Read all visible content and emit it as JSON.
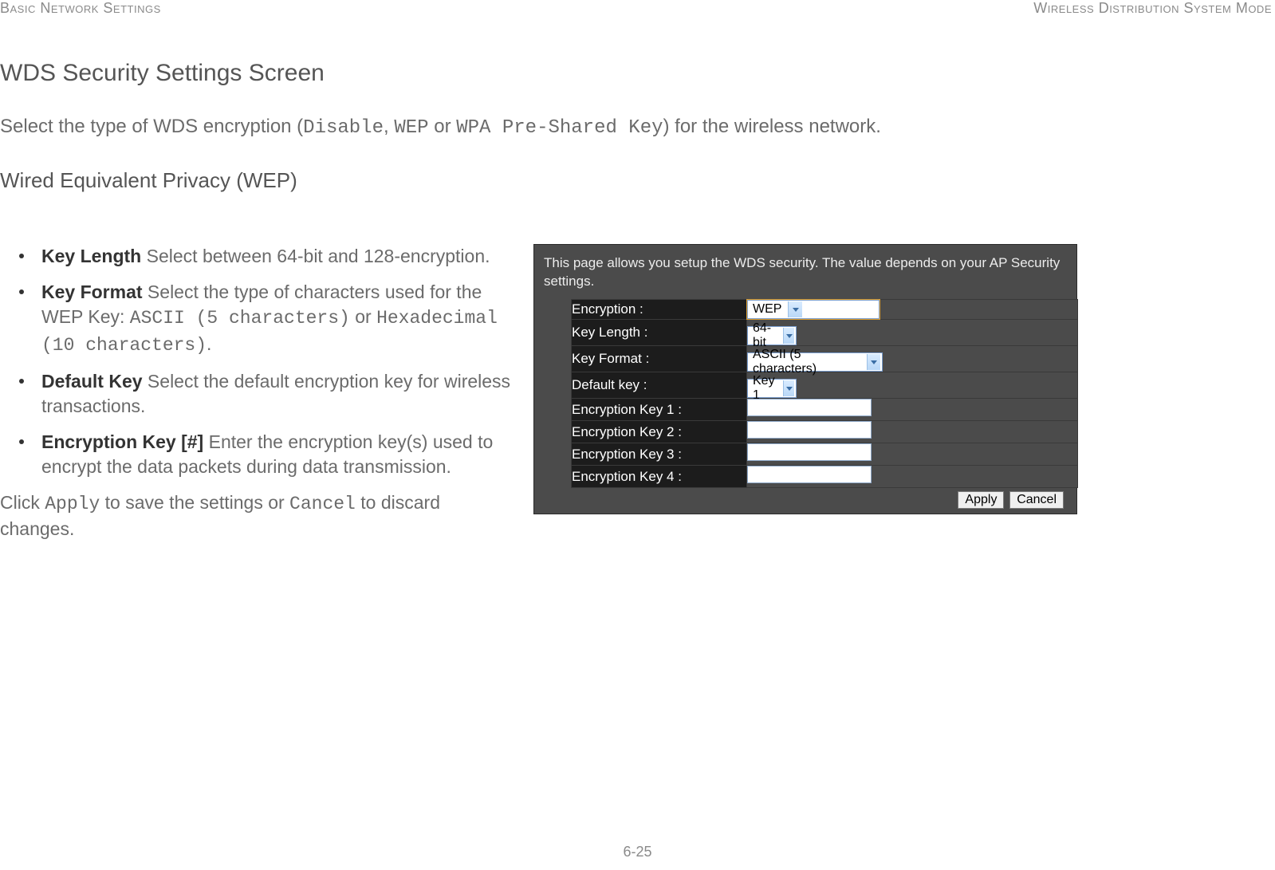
{
  "header": {
    "left": "Basic Network Settings",
    "right": "Wireless Distribution System Mode"
  },
  "title": "WDS Security Settings Screen",
  "intro": {
    "prefix": "Select the type of WDS encryption (",
    "opt1": "Disable",
    "sep1": ", ",
    "opt2": "WEP",
    "sep2": " or ",
    "opt3": "WPA Pre-Shared Key",
    "suffix": ") for the wireless network."
  },
  "subheading": "Wired Equivalent Privacy (WEP)",
  "bullets": [
    {
      "term": "Key Length",
      "desc": "  Select between 64-bit and 128-encryption."
    },
    {
      "term": "Key Format",
      "desc_pre": "  Select the type of characters used for the WEP Key: ",
      "m1": "ASCII (5 characters)",
      "mid": " or ",
      "m2": "Hexadecimal (10 characters)",
      "desc_post": "."
    },
    {
      "term": "Default Key",
      "desc": "  Select the default encryption key for wireless transactions."
    },
    {
      "term": "Encryption Key [#]",
      "desc": "  Enter the encryption key(s) used to encrypt the data packets during data transmission."
    }
  ],
  "apply_sentence": {
    "p1": "Click ",
    "m1": "Apply",
    "p2": " to save the settings or ",
    "m2": "Cancel",
    "p3": " to discard changes."
  },
  "panel": {
    "desc": "This page allows you setup the WDS security. The value depends on your AP Security settings.",
    "rows": {
      "encryption": {
        "label": "Encryption :",
        "value": "WEP"
      },
      "key_length": {
        "label": "Key Length :",
        "value": "64-bit"
      },
      "key_format": {
        "label": "Key Format :",
        "value": "ASCII (5 characters)"
      },
      "default_key": {
        "label": "Default key :",
        "value": "Key 1"
      },
      "ek1": {
        "label": "Encryption Key 1 :"
      },
      "ek2": {
        "label": "Encryption Key 2 :"
      },
      "ek3": {
        "label": "Encryption Key 3 :"
      },
      "ek4": {
        "label": "Encryption Key 4 :"
      }
    },
    "buttons": {
      "apply": "Apply",
      "cancel": "Cancel"
    }
  },
  "page_number": "6-25"
}
